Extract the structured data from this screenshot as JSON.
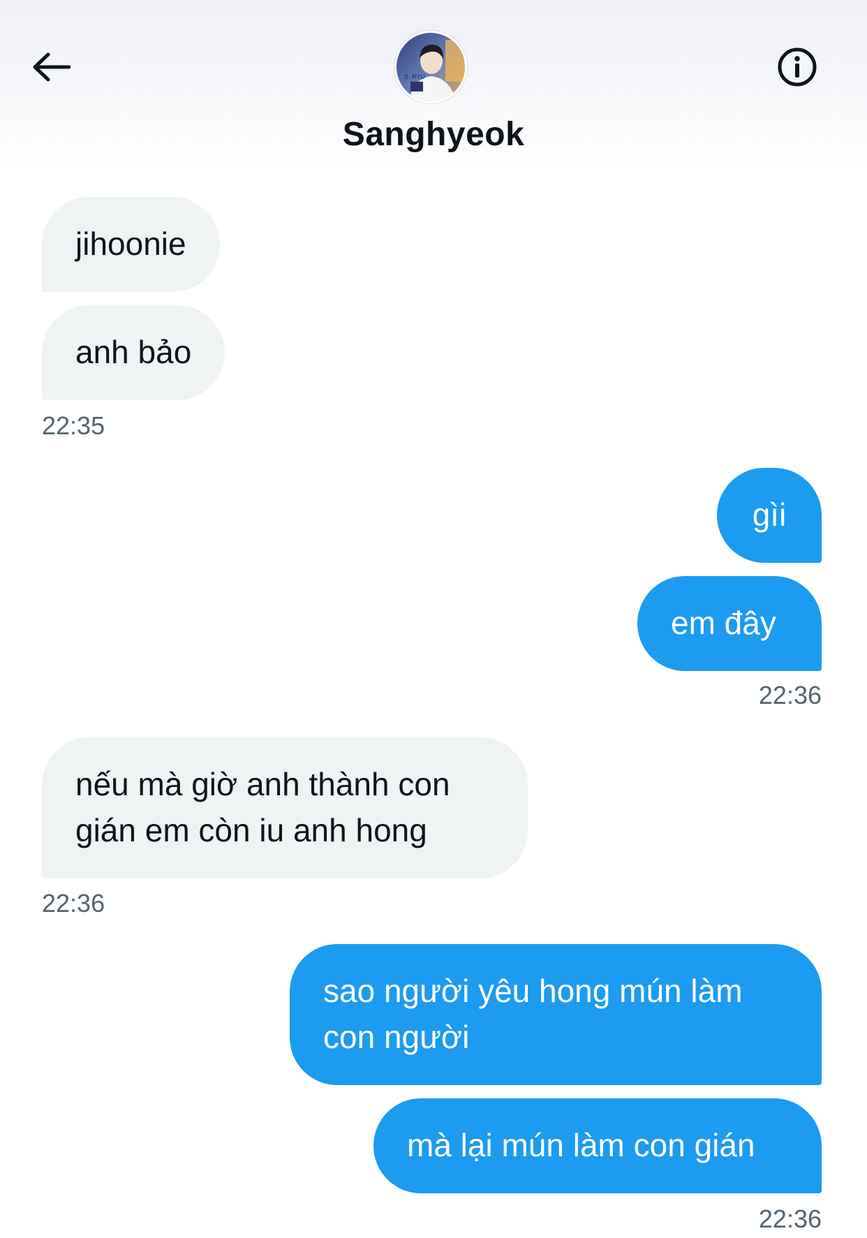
{
  "header": {
    "title": "Sanghyeok",
    "avatar_label": "S. RYU"
  },
  "messages": [
    {
      "direction": "incoming",
      "text": "jihoonie"
    },
    {
      "direction": "incoming",
      "text": "anh bảo"
    },
    {
      "direction": "outgoing",
      "text": "gìi"
    },
    {
      "direction": "outgoing",
      "text": "em đây"
    },
    {
      "direction": "incoming",
      "text": "nếu mà giờ anh thành con gián em còn iu anh hong"
    },
    {
      "direction": "outgoing",
      "text": "sao người yêu hong mún làm con người"
    },
    {
      "direction": "outgoing",
      "text": "mà lại mún làm con gián"
    }
  ],
  "timestamps": [
    "22:35",
    "22:36",
    "22:36",
    "22:36"
  ],
  "colors": {
    "outgoing_bubble": "#1d9bf0",
    "incoming_bubble": "#eff3f4",
    "timestamp": "#536471",
    "title": "#0f1419"
  },
  "icons": {
    "back": "arrow-left-icon",
    "info": "info-circle-icon"
  }
}
